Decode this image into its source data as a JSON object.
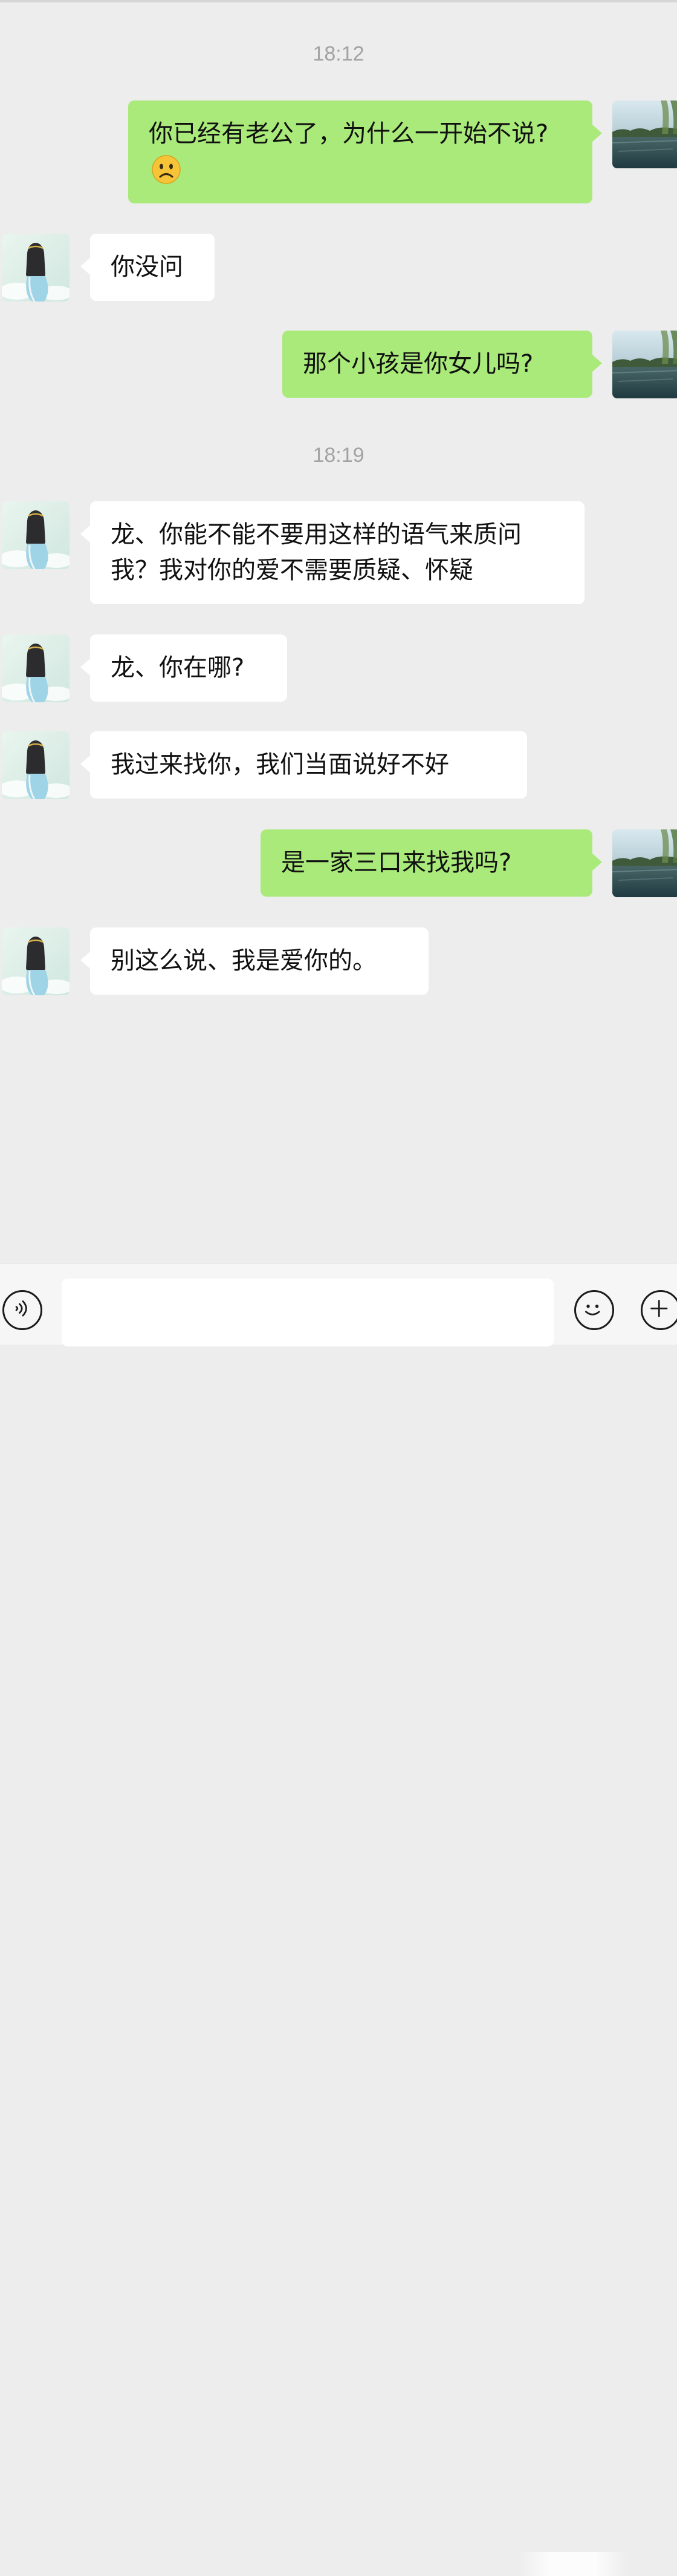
{
  "chat": {
    "timestamps": [
      "18:12",
      "18:19"
    ],
    "messages": [
      {
        "from": "me",
        "text": "你已经有老公了，为什么一开始不说?",
        "emoji": "frowning-face-emoji"
      },
      {
        "from": "contact",
        "text": "你没问"
      },
      {
        "from": "me",
        "text": "那个小孩是你女儿吗?"
      },
      {
        "from": "contact",
        "text": "龙、你能不能不要用这样的语气来质问我？我对你的爱不需要质疑、怀疑"
      },
      {
        "from": "contact",
        "text": "龙、你在哪?"
      },
      {
        "from": "contact",
        "text": "我过来找你，我们当面说好不好"
      },
      {
        "from": "me",
        "text": "是一家三口来找我吗?"
      },
      {
        "from": "contact",
        "text": "别这么说、我是爱你的。"
      }
    ]
  },
  "composer": {
    "input_value": "",
    "icons": [
      "voice-icon",
      "emoji-icon",
      "plus-icon"
    ]
  },
  "colors": {
    "background": "#ededed",
    "outgoing_bubble": "#a9ea7a",
    "incoming_bubble": "#ffffff",
    "timestamp": "#a3a3a3"
  }
}
